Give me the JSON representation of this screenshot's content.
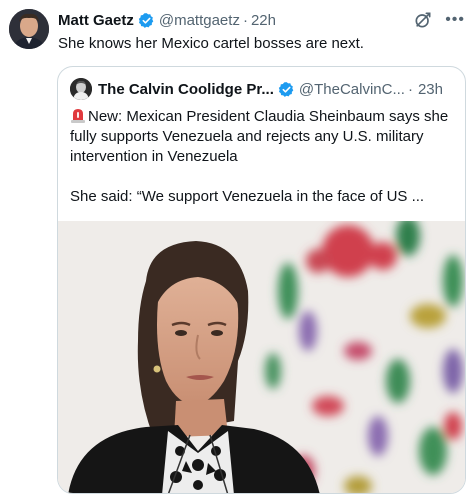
{
  "tweet": {
    "author_name": "Matt Gaetz",
    "author_handle": "@mattgaetz",
    "separator": "·",
    "time": "22h",
    "text": "She knows her Mexico cartel bosses are next."
  },
  "quoted_tweet": {
    "author_name": "The Calvin Coolidge Pr...",
    "author_handle": "@TheCalvinC...",
    "separator": "·",
    "time": "23h",
    "line1": "New: Mexican President Claudia Sheinbaum says she fully supports Venezuela and rejects any U.S. military intervention in Venezuela",
    "line2": "She said: “We support Venezuela in the face of US ..."
  },
  "icons": {
    "verified": "verified-badge-icon",
    "grok": "grok-icon",
    "more": "more-options-icon",
    "siren": "siren-emoji-icon"
  },
  "colors": {
    "verified_blue": "#1d9bf0",
    "secondary_text": "#536471",
    "border": "#cfd9de",
    "siren_red": "#e0393e"
  }
}
